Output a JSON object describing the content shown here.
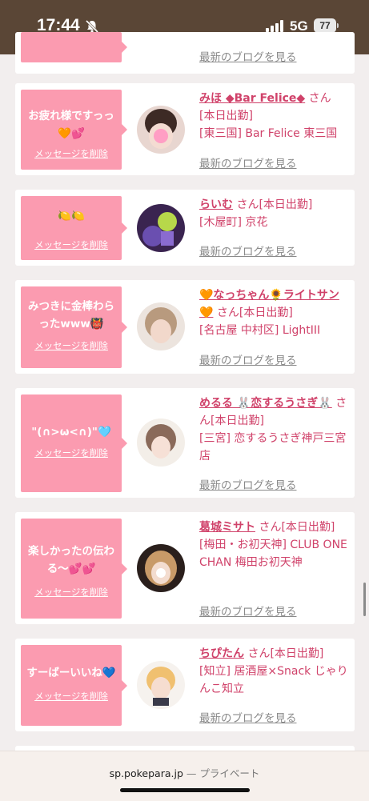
{
  "status_bar": {
    "time": "17:44",
    "network": "5G",
    "battery": "77"
  },
  "top_partial": {
    "blog_label": "最新のブログを見る"
  },
  "messages": [
    {
      "message": "お疲れ様ですっっ🧡💕",
      "delete_label": "メッセージを削除",
      "name": "みほ ◆Bar Felice◆",
      "suffix": "さん",
      "status": "[本日出勤]",
      "location": "[東三国] Bar Felice 東三国",
      "blog_label": "最新のブログを見る"
    },
    {
      "message": "🍋🍋",
      "delete_label": "メッセージを削除",
      "name": "らいむ",
      "suffix": "さん",
      "status": "[本日出勤]",
      "location": "[木屋町] 京花",
      "blog_label": "最新のブログを見る"
    },
    {
      "message": "みつきに金棒わらったwww👹",
      "delete_label": "メッセージを削除",
      "name": "🧡なっちゃん🌻ライトサン🧡",
      "suffix": "さん",
      "status": "[本日出勤]",
      "location": "[名古屋 中村区] LightIII",
      "blog_label": "最新のブログを見る"
    },
    {
      "message": "\"(∩>ω<∩)\"🩵",
      "delete_label": "メッセージを削除",
      "name": "めるる 🐰恋するうさぎ🐰",
      "suffix": "さん",
      "status": "[本日出勤]",
      "location": "[三宮] 恋するうさぎ神戸三宮店",
      "blog_label": "最新のブログを見る"
    },
    {
      "message": "楽しかったの伝わる〜💕💕",
      "delete_label": "メッセージを削除",
      "name": "葛城ミサト",
      "suffix": "さん",
      "status": "[本日出勤]",
      "location": "[梅田・お初天神] CLUB ONE CHAN 梅田お初天神",
      "blog_label": "最新のブログを見る"
    },
    {
      "message": "すーばーいいね💙",
      "delete_label": "メッセージを削除",
      "name": "ちぴたん",
      "suffix": "さん",
      "status": "[本日出勤]",
      "location": "[知立] 居酒屋×Snack じゃりんこ知立",
      "blog_label": "最新のブログを見る"
    }
  ],
  "url_bar": {
    "domain": "sp.pokepara.jp",
    "separator": "—",
    "mode": "プライベート"
  }
}
